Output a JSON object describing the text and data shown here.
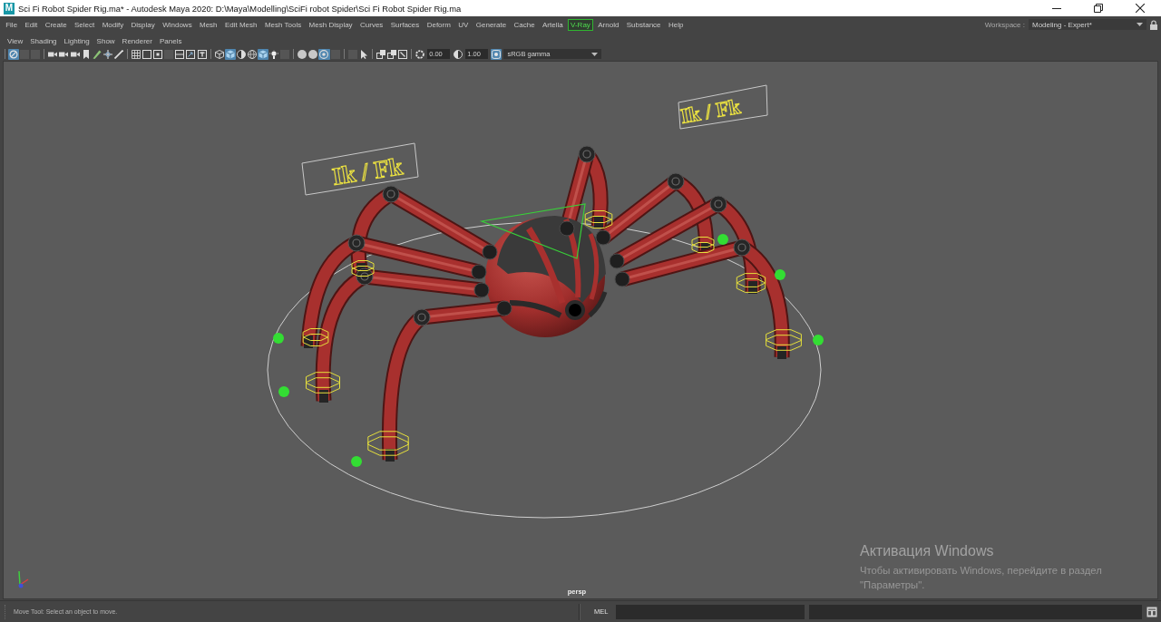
{
  "window": {
    "logo": "M",
    "title": "Sci Fi Robot Spider Rig.ma* - Autodesk Maya 2020: D:\\Maya\\Modelling\\SciFi robot Spider\\Sci Fi Robot Spider Rig.ma"
  },
  "menu_bar": {
    "items": [
      {
        "label": "File",
        "highlighted": false
      },
      {
        "label": "Edit",
        "highlighted": false
      },
      {
        "label": "Create",
        "highlighted": false
      },
      {
        "label": "Select",
        "highlighted": false
      },
      {
        "label": "Modify",
        "highlighted": false
      },
      {
        "label": "Display",
        "highlighted": false
      },
      {
        "label": "Windows",
        "highlighted": false
      },
      {
        "label": "Mesh",
        "highlighted": false
      },
      {
        "label": "Edit Mesh",
        "highlighted": false
      },
      {
        "label": "Mesh Tools",
        "highlighted": false
      },
      {
        "label": "Mesh Display",
        "highlighted": false
      },
      {
        "label": "Curves",
        "highlighted": false
      },
      {
        "label": "Surfaces",
        "highlighted": false
      },
      {
        "label": "Deform",
        "highlighted": false
      },
      {
        "label": "UV",
        "highlighted": false
      },
      {
        "label": "Generate",
        "highlighted": false
      },
      {
        "label": "Cache",
        "highlighted": false
      },
      {
        "label": "Artella",
        "highlighted": false
      },
      {
        "label": "V-Ray",
        "highlighted": true
      },
      {
        "label": "Arnold",
        "highlighted": false
      },
      {
        "label": "Substance",
        "highlighted": false
      },
      {
        "label": "Help",
        "highlighted": false
      }
    ],
    "workspace": {
      "label": "Workspace :",
      "value": "Modeling - Expert*"
    }
  },
  "panel_menu": [
    "View",
    "Shading",
    "Lighting",
    "Show",
    "Renderer",
    "Panels"
  ],
  "panel_toolbar": {
    "groups": [
      {
        "buttons": [
          {
            "on": true,
            "disabled": false
          },
          {
            "on": false,
            "disabled": true
          },
          {
            "on": false,
            "disabled": true
          }
        ]
      },
      {
        "buttons": [
          {
            "on": false,
            "disabled": false
          },
          {
            "on": false,
            "disabled": false
          },
          {
            "on": false,
            "disabled": false
          },
          {
            "on": false,
            "disabled": false
          },
          {
            "on": false,
            "disabled": false
          },
          {
            "on": false,
            "disabled": false
          },
          {
            "on": false,
            "disabled": false
          }
        ]
      },
      {
        "buttons": [
          {
            "on": false,
            "disabled": false
          },
          {
            "on": false,
            "disabled": false
          },
          {
            "on": false,
            "disabled": false
          },
          {
            "on": false,
            "disabled": true
          },
          {
            "on": false,
            "disabled": false
          },
          {
            "on": false,
            "disabled": false
          },
          {
            "on": false,
            "disabled": false
          }
        ]
      },
      {
        "buttons": [
          {
            "on": false,
            "disabled": false
          },
          {
            "on": true,
            "disabled": false
          },
          {
            "on": false,
            "disabled": false
          },
          {
            "on": false,
            "disabled": false
          },
          {
            "on": true,
            "disabled": false
          },
          {
            "on": false,
            "disabled": false
          },
          {
            "on": false,
            "disabled": true
          }
        ]
      },
      {
        "buttons": [
          {
            "on": false,
            "disabled": false
          },
          {
            "on": false,
            "disabled": false
          },
          {
            "on": true,
            "disabled": false
          },
          {
            "on": false,
            "disabled": true
          }
        ]
      },
      {
        "buttons": [
          {
            "on": false,
            "disabled": true
          },
          {
            "on": false,
            "disabled": false
          }
        ]
      },
      {
        "buttons": [
          {
            "on": false,
            "disabled": false
          },
          {
            "on": false,
            "disabled": false
          },
          {
            "on": false,
            "disabled": false
          }
        ]
      }
    ],
    "exposure": "0.00",
    "gamma": "1.00",
    "color_management": {
      "on": true
    },
    "view_transform": "sRGB gamma"
  },
  "viewport": {
    "labels": [
      "Ik / Fk",
      "Ik / Fk"
    ],
    "camera": "persp"
  },
  "os_notice": {
    "title": "Активация Windows",
    "lines": [
      "Чтобы активировать Windows, перейдите в раздел",
      "\"Параметры\"."
    ]
  },
  "status_bar": {
    "help_line": "Move Tool: Select an object to move.",
    "command_language": "MEL"
  }
}
